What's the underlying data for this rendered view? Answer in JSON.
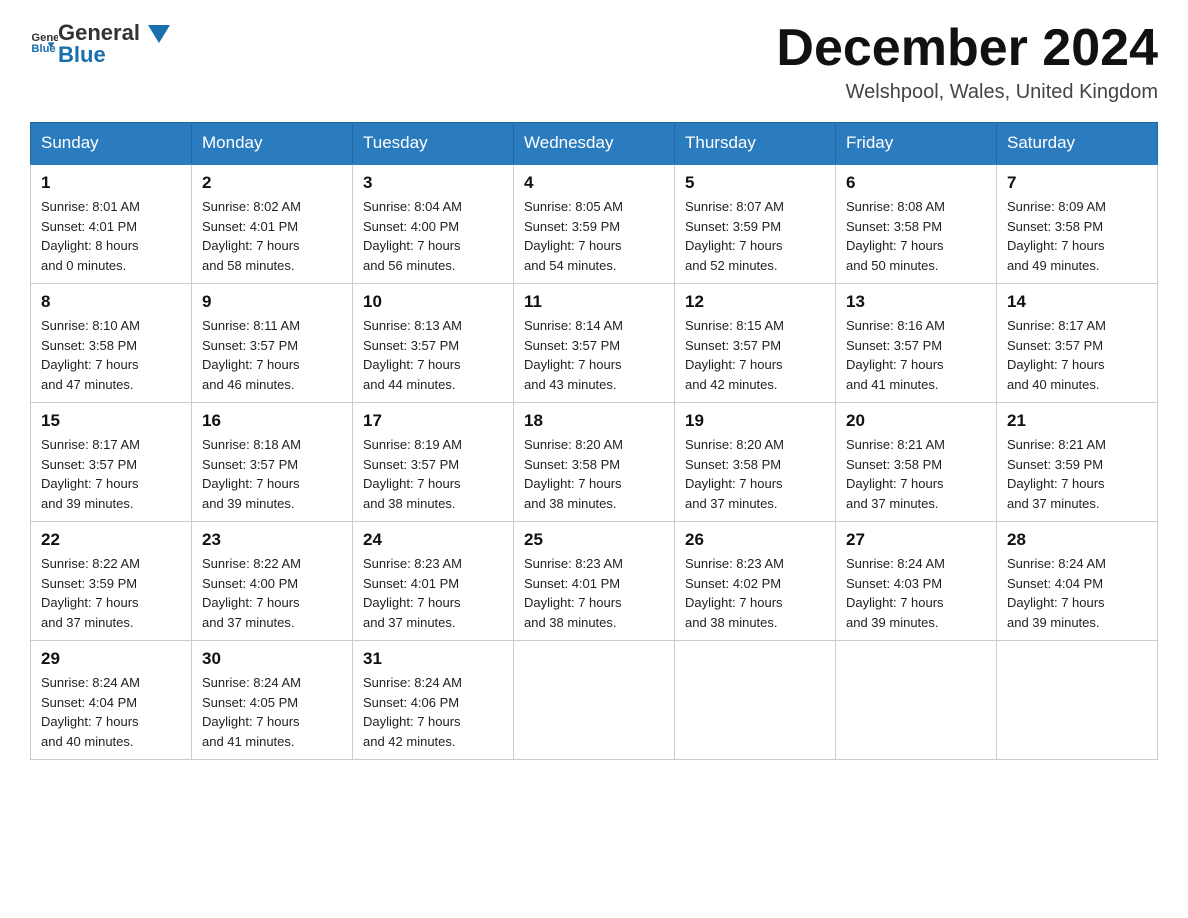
{
  "header": {
    "logo_general": "General",
    "logo_blue": "Blue",
    "month_title": "December 2024",
    "location": "Welshpool, Wales, United Kingdom"
  },
  "days_of_week": [
    "Sunday",
    "Monday",
    "Tuesday",
    "Wednesday",
    "Thursday",
    "Friday",
    "Saturday"
  ],
  "weeks": [
    [
      {
        "day": "1",
        "sunrise": "8:01 AM",
        "sunset": "4:01 PM",
        "daylight": "8 hours and 0 minutes."
      },
      {
        "day": "2",
        "sunrise": "8:02 AM",
        "sunset": "4:01 PM",
        "daylight": "7 hours and 58 minutes."
      },
      {
        "day": "3",
        "sunrise": "8:04 AM",
        "sunset": "4:00 PM",
        "daylight": "7 hours and 56 minutes."
      },
      {
        "day": "4",
        "sunrise": "8:05 AM",
        "sunset": "3:59 PM",
        "daylight": "7 hours and 54 minutes."
      },
      {
        "day": "5",
        "sunrise": "8:07 AM",
        "sunset": "3:59 PM",
        "daylight": "7 hours and 52 minutes."
      },
      {
        "day": "6",
        "sunrise": "8:08 AM",
        "sunset": "3:58 PM",
        "daylight": "7 hours and 50 minutes."
      },
      {
        "day": "7",
        "sunrise": "8:09 AM",
        "sunset": "3:58 PM",
        "daylight": "7 hours and 49 minutes."
      }
    ],
    [
      {
        "day": "8",
        "sunrise": "8:10 AM",
        "sunset": "3:58 PM",
        "daylight": "7 hours and 47 minutes."
      },
      {
        "day": "9",
        "sunrise": "8:11 AM",
        "sunset": "3:57 PM",
        "daylight": "7 hours and 46 minutes."
      },
      {
        "day": "10",
        "sunrise": "8:13 AM",
        "sunset": "3:57 PM",
        "daylight": "7 hours and 44 minutes."
      },
      {
        "day": "11",
        "sunrise": "8:14 AM",
        "sunset": "3:57 PM",
        "daylight": "7 hours and 43 minutes."
      },
      {
        "day": "12",
        "sunrise": "8:15 AM",
        "sunset": "3:57 PM",
        "daylight": "7 hours and 42 minutes."
      },
      {
        "day": "13",
        "sunrise": "8:16 AM",
        "sunset": "3:57 PM",
        "daylight": "7 hours and 41 minutes."
      },
      {
        "day": "14",
        "sunrise": "8:17 AM",
        "sunset": "3:57 PM",
        "daylight": "7 hours and 40 minutes."
      }
    ],
    [
      {
        "day": "15",
        "sunrise": "8:17 AM",
        "sunset": "3:57 PM",
        "daylight": "7 hours and 39 minutes."
      },
      {
        "day": "16",
        "sunrise": "8:18 AM",
        "sunset": "3:57 PM",
        "daylight": "7 hours and 39 minutes."
      },
      {
        "day": "17",
        "sunrise": "8:19 AM",
        "sunset": "3:57 PM",
        "daylight": "7 hours and 38 minutes."
      },
      {
        "day": "18",
        "sunrise": "8:20 AM",
        "sunset": "3:58 PM",
        "daylight": "7 hours and 38 minutes."
      },
      {
        "day": "19",
        "sunrise": "8:20 AM",
        "sunset": "3:58 PM",
        "daylight": "7 hours and 37 minutes."
      },
      {
        "day": "20",
        "sunrise": "8:21 AM",
        "sunset": "3:58 PM",
        "daylight": "7 hours and 37 minutes."
      },
      {
        "day": "21",
        "sunrise": "8:21 AM",
        "sunset": "3:59 PM",
        "daylight": "7 hours and 37 minutes."
      }
    ],
    [
      {
        "day": "22",
        "sunrise": "8:22 AM",
        "sunset": "3:59 PM",
        "daylight": "7 hours and 37 minutes."
      },
      {
        "day": "23",
        "sunrise": "8:22 AM",
        "sunset": "4:00 PM",
        "daylight": "7 hours and 37 minutes."
      },
      {
        "day": "24",
        "sunrise": "8:23 AM",
        "sunset": "4:01 PM",
        "daylight": "7 hours and 37 minutes."
      },
      {
        "day": "25",
        "sunrise": "8:23 AM",
        "sunset": "4:01 PM",
        "daylight": "7 hours and 38 minutes."
      },
      {
        "day": "26",
        "sunrise": "8:23 AM",
        "sunset": "4:02 PM",
        "daylight": "7 hours and 38 minutes."
      },
      {
        "day": "27",
        "sunrise": "8:24 AM",
        "sunset": "4:03 PM",
        "daylight": "7 hours and 39 minutes."
      },
      {
        "day": "28",
        "sunrise": "8:24 AM",
        "sunset": "4:04 PM",
        "daylight": "7 hours and 39 minutes."
      }
    ],
    [
      {
        "day": "29",
        "sunrise": "8:24 AM",
        "sunset": "4:04 PM",
        "daylight": "7 hours and 40 minutes."
      },
      {
        "day": "30",
        "sunrise": "8:24 AM",
        "sunset": "4:05 PM",
        "daylight": "7 hours and 41 minutes."
      },
      {
        "day": "31",
        "sunrise": "8:24 AM",
        "sunset": "4:06 PM",
        "daylight": "7 hours and 42 minutes."
      },
      null,
      null,
      null,
      null
    ]
  ],
  "labels": {
    "sunrise": "Sunrise:",
    "sunset": "Sunset:",
    "daylight": "Daylight:"
  }
}
